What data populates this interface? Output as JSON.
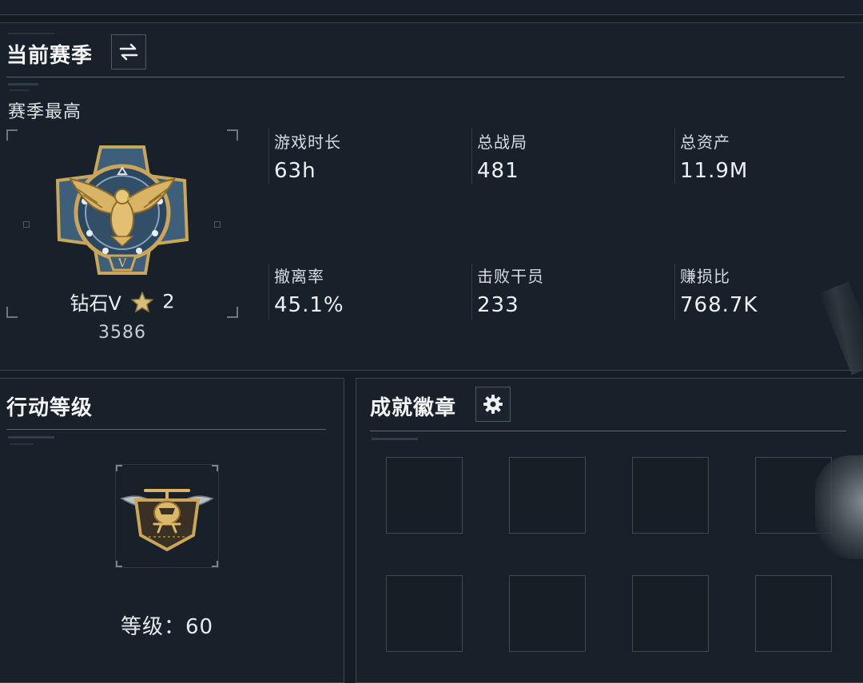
{
  "season": {
    "title": "当前赛季",
    "subtitle": "赛季最高",
    "rank_name": "钻石V",
    "rank_stars": "2",
    "rank_score": "3586",
    "stats": [
      {
        "label": "游戏时长",
        "value": "63h"
      },
      {
        "label": "总战局",
        "value": "481"
      },
      {
        "label": "总资产",
        "value": "11.9M"
      },
      {
        "label": "撤离率",
        "value": "45.1%"
      },
      {
        "label": "击败干员",
        "value": "233"
      },
      {
        "label": "赚损比",
        "value": "768.7K"
      }
    ]
  },
  "action_level": {
    "title": "行动等级",
    "level_label": "等级：",
    "level_value": "60"
  },
  "achievements": {
    "title": "成就徽章",
    "slot_count": 8
  },
  "icons": {
    "switch": "swap-arrows-icon",
    "settings": "gear-icon",
    "rank_emblem": "eagle-rank-emblem-icon",
    "star": "star-icon",
    "level_emblem": "helicopter-level-emblem-icon"
  },
  "colors": {
    "background": "#141c24",
    "panel": "#18212a",
    "border": "#3a4650",
    "gold": "#c9a65a",
    "text": "#eef1f3"
  }
}
